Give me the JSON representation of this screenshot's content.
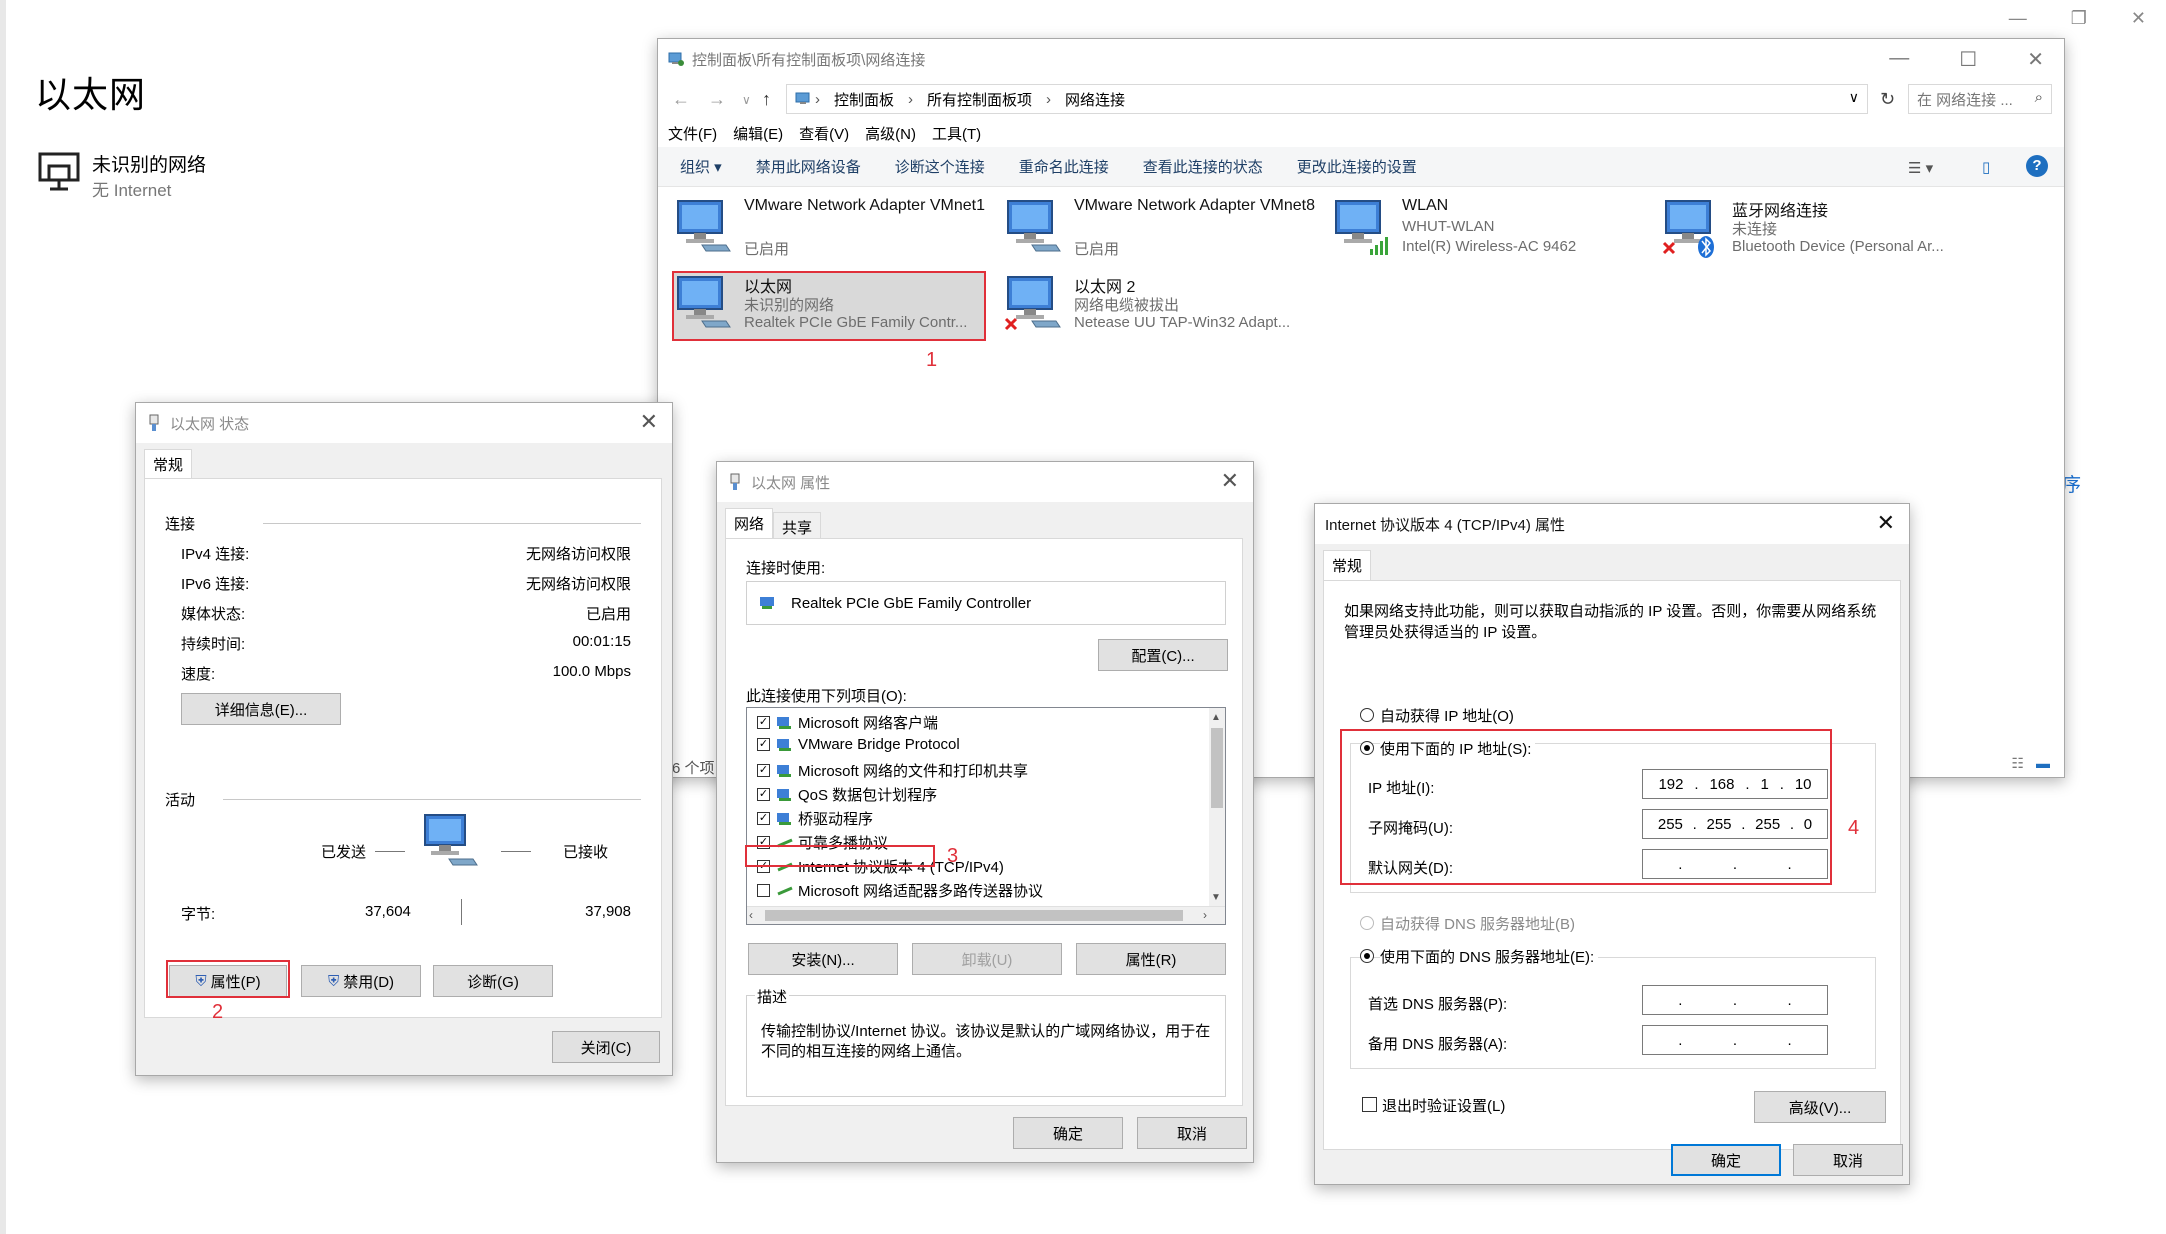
{
  "settings": {
    "title": "以太网",
    "network_name": "未识别的网络",
    "network_sub": "无 Internet",
    "edge_text": "序"
  },
  "explorer": {
    "title": "控制面板\\所有控制面板项\\网络连接",
    "breadcrumbs": [
      "控制面板",
      "所有控制面板项",
      "网络连接"
    ],
    "search_placeholder": "在 网络连接 ...",
    "menu": [
      "文件(F)",
      "编辑(E)",
      "查看(V)",
      "高级(N)",
      "工具(T)"
    ],
    "commands": [
      "组织 ▾",
      "禁用此网络设备",
      "诊断这个连接",
      "重命名此连接",
      "查看此连接的状态",
      "更改此连接的设置"
    ],
    "adapters": [
      {
        "name": "VMware Network Adapter VMnet1",
        "status": "已启用",
        "device": ""
      },
      {
        "name": "VMware Network Adapter VMnet8",
        "status": "已启用",
        "device": ""
      },
      {
        "name": "WLAN",
        "status": "WHUT-WLAN",
        "device": "Intel(R) Wireless-AC 9462"
      },
      {
        "name": "蓝牙网络连接",
        "status": "未连接",
        "device": "Bluetooth Device (Personal Ar..."
      },
      {
        "name": "以太网",
        "status": "未识别的网络",
        "device": "Realtek PCIe GbE Family Contr..."
      },
      {
        "name": "以太网 2",
        "status": "网络电缆被拔出",
        "device": "Netease UU TAP-Win32 Adapt..."
      }
    ],
    "status_bar": "6 个项",
    "annotation": "1"
  },
  "status_dialog": {
    "title": "以太网 状态",
    "tab": "常规",
    "section_connection": "连接",
    "rows": [
      {
        "label": "IPv4 连接:",
        "value": "无网络访问权限"
      },
      {
        "label": "IPv6 连接:",
        "value": "无网络访问权限"
      },
      {
        "label": "媒体状态:",
        "value": "已启用"
      },
      {
        "label": "持续时间:",
        "value": "00:01:15"
      },
      {
        "label": "速度:",
        "value": "100.0 Mbps"
      }
    ],
    "details_button": "详细信息(E)...",
    "section_activity": "活动",
    "sent_label": "已发送",
    "received_label": "已接收",
    "bytes_label": "字节:",
    "bytes_sent": "37,604",
    "bytes_received": "37,908",
    "properties_button": "属性(P)",
    "disable_button": "禁用(D)",
    "diagnose_button": "诊断(G)",
    "close_button": "关闭(C)",
    "annotation": "2"
  },
  "props_dialog": {
    "title": "以太网 属性",
    "tabs": [
      "网络",
      "共享"
    ],
    "connect_using_label": "连接时使用:",
    "adapter_name": "Realtek PCIe GbE Family Controller",
    "configure_button": "配置(C)...",
    "items_label": "此连接使用下列项目(O):",
    "items": [
      {
        "label": "Microsoft 网络客户端",
        "checked": true
      },
      {
        "label": "VMware Bridge Protocol",
        "checked": true
      },
      {
        "label": "Microsoft 网络的文件和打印机共享",
        "checked": true
      },
      {
        "label": "QoS 数据包计划程序",
        "checked": true
      },
      {
        "label": "桥驱动程序",
        "checked": true
      },
      {
        "label": "可靠多播协议",
        "checked": true
      },
      {
        "label": "Internet 协议版本 4 (TCP/IPv4)",
        "checked": true
      },
      {
        "label": "Microsoft 网络适配器多路传送器协议",
        "checked": false
      }
    ],
    "install_button": "安装(N)...",
    "uninstall_button": "卸载(U)",
    "properties_button": "属性(R)",
    "description_label": "描述",
    "description_text": "传输控制协议/Internet 协议。该协议是默认的广域网络协议，用于在不同的相互连接的网络上通信。",
    "ok_button": "确定",
    "cancel_button": "取消",
    "annotation": "3"
  },
  "ipv4_dialog": {
    "title": "Internet 协议版本 4 (TCP/IPv4) 属性",
    "tab": "常规",
    "intro": "如果网络支持此功能，则可以获取自动指派的 IP 设置。否则，你需要从网络系统管理员处获得适当的 IP 设置。",
    "auto_ip_label": "自动获得 IP 地址(O)",
    "manual_ip_label": "使用下面的 IP 地址(S):",
    "ip_label": "IP 地址(I):",
    "ip_octets": [
      "192",
      "168",
      "1",
      "10"
    ],
    "mask_label": "子网掩码(U):",
    "mask_octets": [
      "255",
      "255",
      "255",
      "0"
    ],
    "gateway_label": "默认网关(D):",
    "auto_dns_label": "自动获得 DNS 服务器地址(B)",
    "manual_dns_label": "使用下面的 DNS 服务器地址(E):",
    "pref_dns_label": "首选 DNS 服务器(P):",
    "alt_dns_label": "备用 DNS 服务器(A):",
    "validate_label": "退出时验证设置(L)",
    "advanced_button": "高级(V)...",
    "ok_button": "确定",
    "cancel_button": "取消",
    "annotation": "4"
  },
  "colors": {
    "annotation_red": "#e0303a",
    "accent_blue": "#0078d7"
  }
}
